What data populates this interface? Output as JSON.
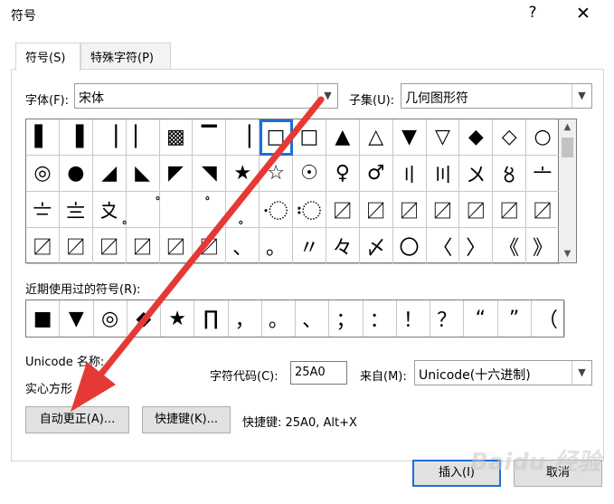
{
  "window": {
    "title": "符号",
    "help_label": "?",
    "close_label": "✕"
  },
  "tabs": [
    {
      "label": "符号(S)",
      "active": true
    },
    {
      "label": "特殊字符(P)",
      "active": false
    }
  ],
  "font": {
    "label": "字体(F):",
    "value": "宋体"
  },
  "subset": {
    "label": "子集(U):",
    "value": "几何图形符"
  },
  "symbols": [
    [
      "▌",
      "▐",
      "▕",
      "▏",
      "▩",
      "▔",
      "▕",
      "□",
      "□",
      "▲",
      "△",
      "▼",
      "▽",
      "◆",
      "◇",
      "○"
    ],
    [
      "◎",
      "●",
      "◢",
      "◣",
      "◤",
      "◥",
      "★",
      "☆",
      "☉",
      "♀",
      "♂",
      "〢",
      "〣",
      "〤",
      "〥",
      "〦"
    ],
    [
      "〧",
      "〨",
      "〩",
      "〪",
      "〫",
      "〬",
      "〭",
      "〮",
      "〯",
      "〼",
      "〼",
      "〼",
      "〼",
      "〼",
      "〼",
      "〼"
    ],
    [
      "〼",
      "〼",
      "〼",
      "〼",
      "〼",
      "〼",
      "、",
      "。",
      "〃",
      "々",
      "〆",
      "〇",
      "〈",
      "〉",
      "《",
      "》"
    ]
  ],
  "selected_symbol": {
    "row": 0,
    "col": 7
  },
  "recent": {
    "label": "近期使用过的符号(R):",
    "symbols": [
      "■",
      "▼",
      "◎",
      "◆",
      "★",
      "∏",
      "，",
      "。",
      "、",
      "；",
      "：",
      "！",
      "？",
      "“",
      "”",
      "（"
    ]
  },
  "unicode_name": {
    "label": "Unicode 名称:",
    "value": "实心方形"
  },
  "char_code": {
    "label": "字符代码(C):",
    "value": "25A0"
  },
  "from": {
    "label": "来自(M):",
    "value": "Unicode(十六进制)"
  },
  "buttons": {
    "autocorrect": "自动更正(A)...",
    "shortcut": "快捷键(K)...",
    "insert": "插入(I)",
    "cancel": "取消"
  },
  "shortcut_info": "快捷键: 25A0, Alt+X",
  "watermark": "Baidu 经验",
  "colors": {
    "accent": "#1e6fd6",
    "annotation_arrow": "#e53935"
  }
}
